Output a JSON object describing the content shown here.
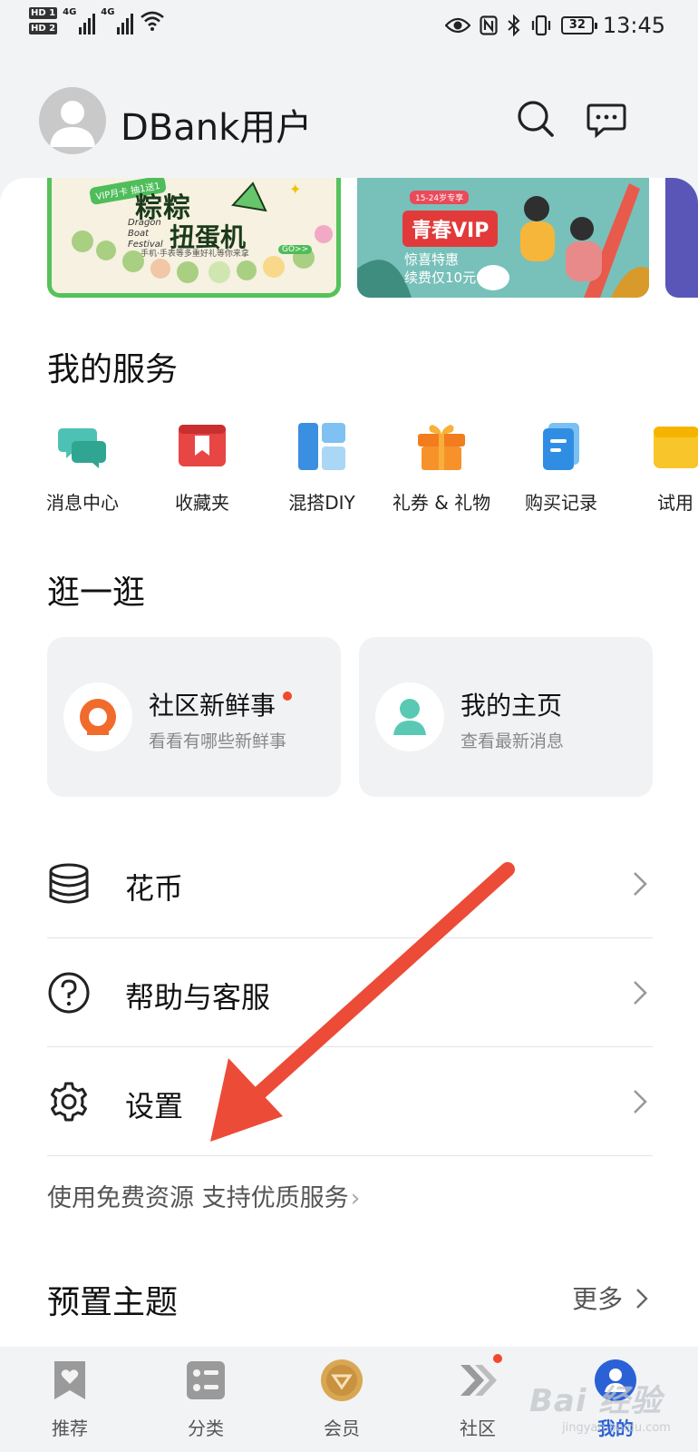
{
  "status_bar": {
    "hd1": "HD 1",
    "hd2": "HD 2",
    "sig1": "4G",
    "sig2": "4G",
    "battery": "32",
    "time": "13:45"
  },
  "header": {
    "username": "DBank用户"
  },
  "banners": {
    "b1": {
      "vip": "VIP月卡 抽1送1",
      "title1": "粽粽",
      "title2": "扭蛋机",
      "en": "Dragon Boat Festival",
      "tag": "手机·手表等多重好礼等你来拿",
      "go": "GO>>"
    },
    "b2": {
      "top": "15-24岁专享",
      "title": "青春VIP",
      "sub1": "惊喜特惠",
      "sub2": "续费仅10元"
    }
  },
  "services": {
    "title": "我的服务",
    "items": [
      {
        "label": "消息中心"
      },
      {
        "label": "收藏夹"
      },
      {
        "label": "混搭DIY"
      },
      {
        "label": "礼券 & 礼物"
      },
      {
        "label": "购买记录"
      },
      {
        "label": "试用"
      }
    ]
  },
  "browse": {
    "title": "逛一逛",
    "cards": [
      {
        "title": "社区新鲜事",
        "subtitle": "看看有哪些新鲜事"
      },
      {
        "title": "我的主页",
        "subtitle": "查看最新消息"
      }
    ]
  },
  "menu": {
    "items": [
      {
        "label": "花币"
      },
      {
        "label": "帮助与客服"
      },
      {
        "label": "设置"
      }
    ]
  },
  "promo": {
    "text": "使用免费资源 支持优质服务",
    "arrow": "›"
  },
  "themes": {
    "title": "预置主题",
    "more": "更多"
  },
  "tabbar": {
    "tabs": [
      {
        "label": "推荐"
      },
      {
        "label": "分类"
      },
      {
        "label": "会员"
      },
      {
        "label": "社区"
      },
      {
        "label": "我的"
      }
    ]
  },
  "watermark": {
    "text": "Bai 经验",
    "sub": "jingyan.baidu.com"
  },
  "colors": {
    "accent": "#2a62d6",
    "annotation_arrow": "#ec4b37",
    "badge": "#f0492d"
  }
}
